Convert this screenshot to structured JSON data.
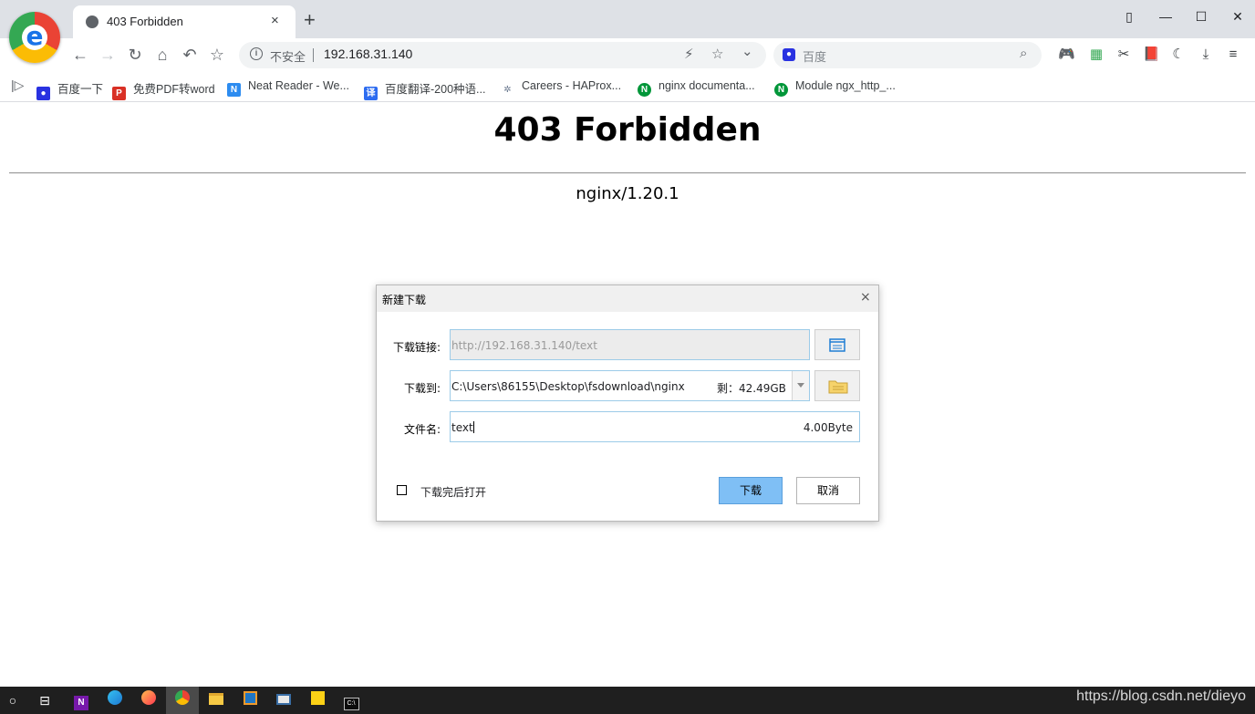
{
  "browser": {
    "tab": {
      "title": "403 Forbidden",
      "close_icon": "×"
    },
    "new_tab_icon": "+",
    "window_controls": {
      "restore": "▯",
      "minimize": "—",
      "maximize": "☐",
      "close": "✕"
    },
    "nav": {
      "back": "←",
      "forward": "→",
      "reload": "↻",
      "home": "⌂",
      "undo": "↶",
      "bookmark": "☆"
    },
    "omnibox": {
      "security_label": "不安全",
      "url": "192.168.31.140",
      "bolt": "⚡",
      "star": "☆",
      "chevron": "⌄"
    },
    "search": {
      "placeholder": "百度",
      "icon": "⌕"
    },
    "extensions": [
      "🎮",
      "▦",
      "✂",
      "📕",
      "☾",
      "⤓",
      "≡"
    ]
  },
  "bookmarks": [
    {
      "label": "百度一下",
      "icon": "🐾",
      "color": "#2932e1"
    },
    {
      "label": "免费PDF转word",
      "icon": "P",
      "color": "#d93025"
    },
    {
      "label": "Neat Reader - We...",
      "icon": "N",
      "color": "#2d8cf0"
    },
    {
      "label": "百度翻译-200种语...",
      "icon": "译",
      "color": "#2d6cf0"
    },
    {
      "label": "Careers - HAProx...",
      "icon": "✲",
      "color": "#6b7a90"
    },
    {
      "label": "nginx documenta...",
      "icon": "N",
      "color": "#009639"
    },
    {
      "label": "Module ngx_http_...",
      "icon": "N",
      "color": "#009639"
    }
  ],
  "page": {
    "heading": "403 Forbidden",
    "server": "nginx/1.20.1"
  },
  "dialog": {
    "title": "新建下载",
    "close_icon": "×",
    "url_label": "下载链接:",
    "url_value": "http://192.168.31.140/text",
    "path_label": "下载到:",
    "path_value": "C:\\Users\\86155\\Desktop\\fsdownload\\nginx",
    "free_space": "剩：42.49GB",
    "filename_label": "文件名:",
    "filename_value": "text",
    "file_size": "4.00Byte",
    "open_after_label": "下载完后打开",
    "download_button": "下载",
    "cancel_button": "取消",
    "colors": {
      "accent": "#7fbff5",
      "field_border": "#9ccbe8"
    }
  },
  "taskbar": {
    "watermark": "https://blog.csdn.net/dieyo"
  }
}
